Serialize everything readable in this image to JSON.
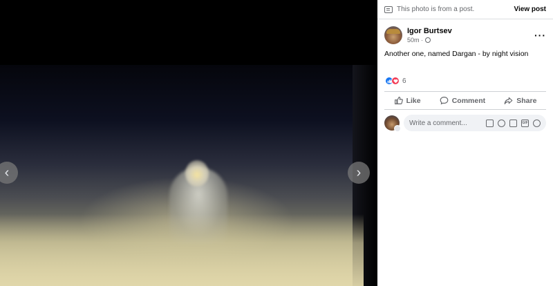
{
  "notice": {
    "text": "This photo is from a post.",
    "link": "View post"
  },
  "post": {
    "author": "Igor Burtsev",
    "time": "50m ·",
    "caption": "Another one, named Dargan - by night vision",
    "reaction_count": "6"
  },
  "actions": {
    "like": "Like",
    "comment": "Comment",
    "share": "Share"
  },
  "comment_input": {
    "placeholder": "Write a comment..."
  },
  "nav": {
    "prev": "‹",
    "next": "›"
  },
  "icons": [
    "document-icon",
    "globe-icon",
    "more-icon",
    "like-reaction-icon",
    "love-reaction-icon",
    "like-icon",
    "comment-icon",
    "share-icon",
    "avatar-icon",
    "sticker-icon",
    "emoji-icon",
    "camera-icon",
    "gif-icon"
  ],
  "colors": {
    "accent": "#1877f2",
    "love": "#f33e58",
    "text_secondary": "#65676b"
  }
}
